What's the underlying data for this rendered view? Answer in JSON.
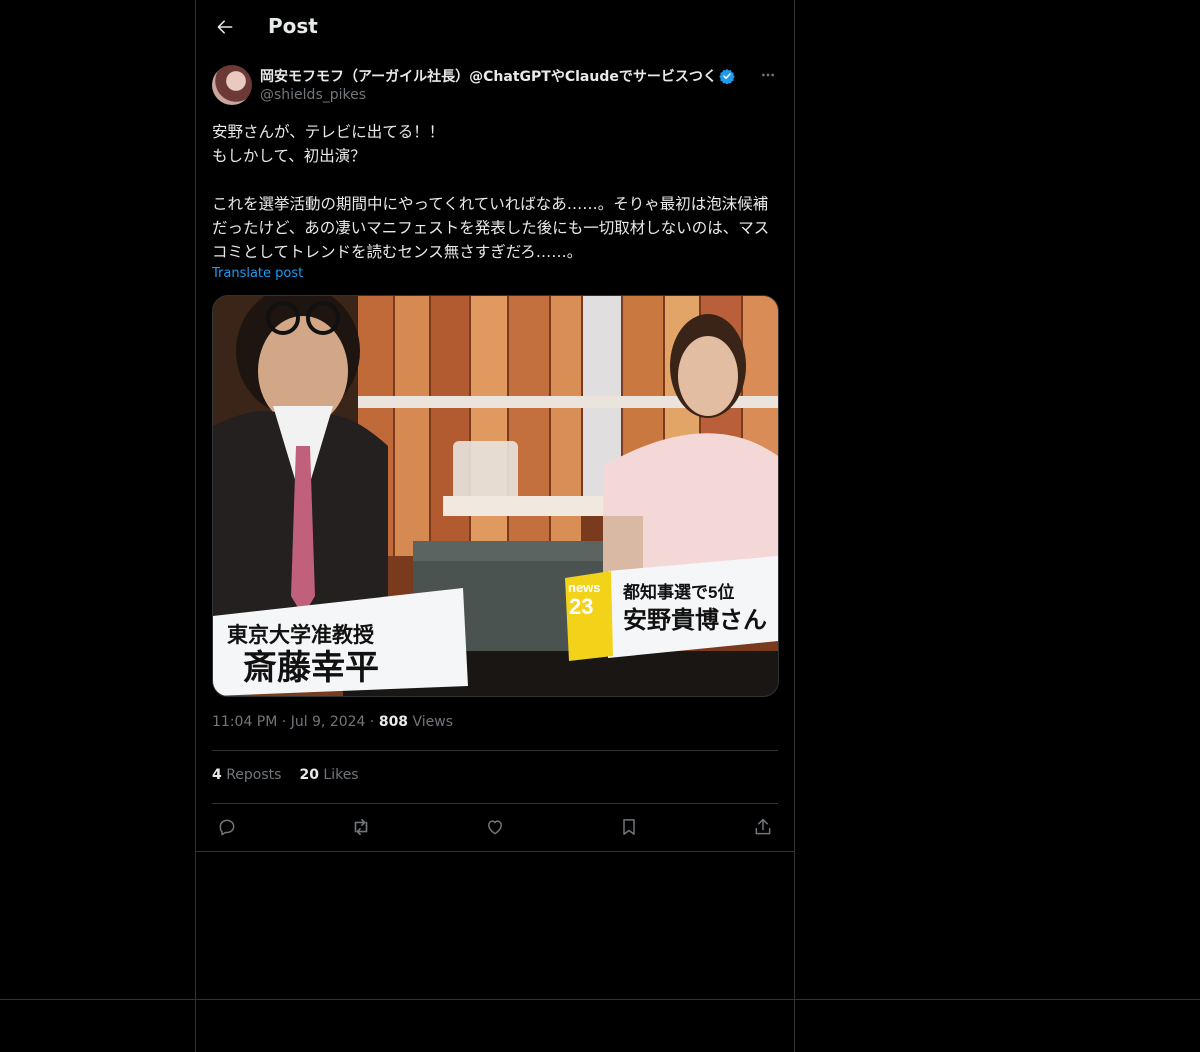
{
  "header": {
    "title": "Post"
  },
  "author": {
    "display_name": "岡安モフモフ（アーガイル社長）@ChatGPTやClaudeでサービスつく",
    "handle": "@shields_pikes"
  },
  "post": {
    "text": "安野さんが、テレビに出てる！！\nもしかして、初出演？\n\nこれを選挙活動の期間中にやってくれていればなあ……。そりゃ最初は泡沫候補だったけど、あの凄いマニフェストを発表した後にも一切取材しないのは、マスコミとしてトレンドを読むセンス無さすぎだろ……。",
    "translate_label": "Translate post",
    "image": {
      "left_caption_title": "東京大学准教授",
      "left_caption_name": "斎藤幸平",
      "right_caption_title": "都知事選で5位",
      "right_caption_name": "安野貴博さん",
      "logo_text": "news",
      "logo_number": "23"
    },
    "time": "11:04 PM",
    "date": "Jul 9, 2024",
    "views_count": "808",
    "views_label": "Views",
    "reposts_count": "4",
    "reposts_label": "Reposts",
    "likes_count": "20",
    "likes_label": "Likes"
  },
  "icons": {
    "back": "arrow-left-icon",
    "more": "more-horizontal-icon",
    "verified": "verified-badge-icon",
    "reply": "reply-icon",
    "repost": "repost-icon",
    "like": "heart-icon",
    "bookmark": "bookmark-icon",
    "share": "share-icon"
  },
  "colors": {
    "background": "#000000",
    "text": "#e7e9ea",
    "secondary_text": "#71767b",
    "accent": "#1d9bf0",
    "border": "#2f3336"
  }
}
